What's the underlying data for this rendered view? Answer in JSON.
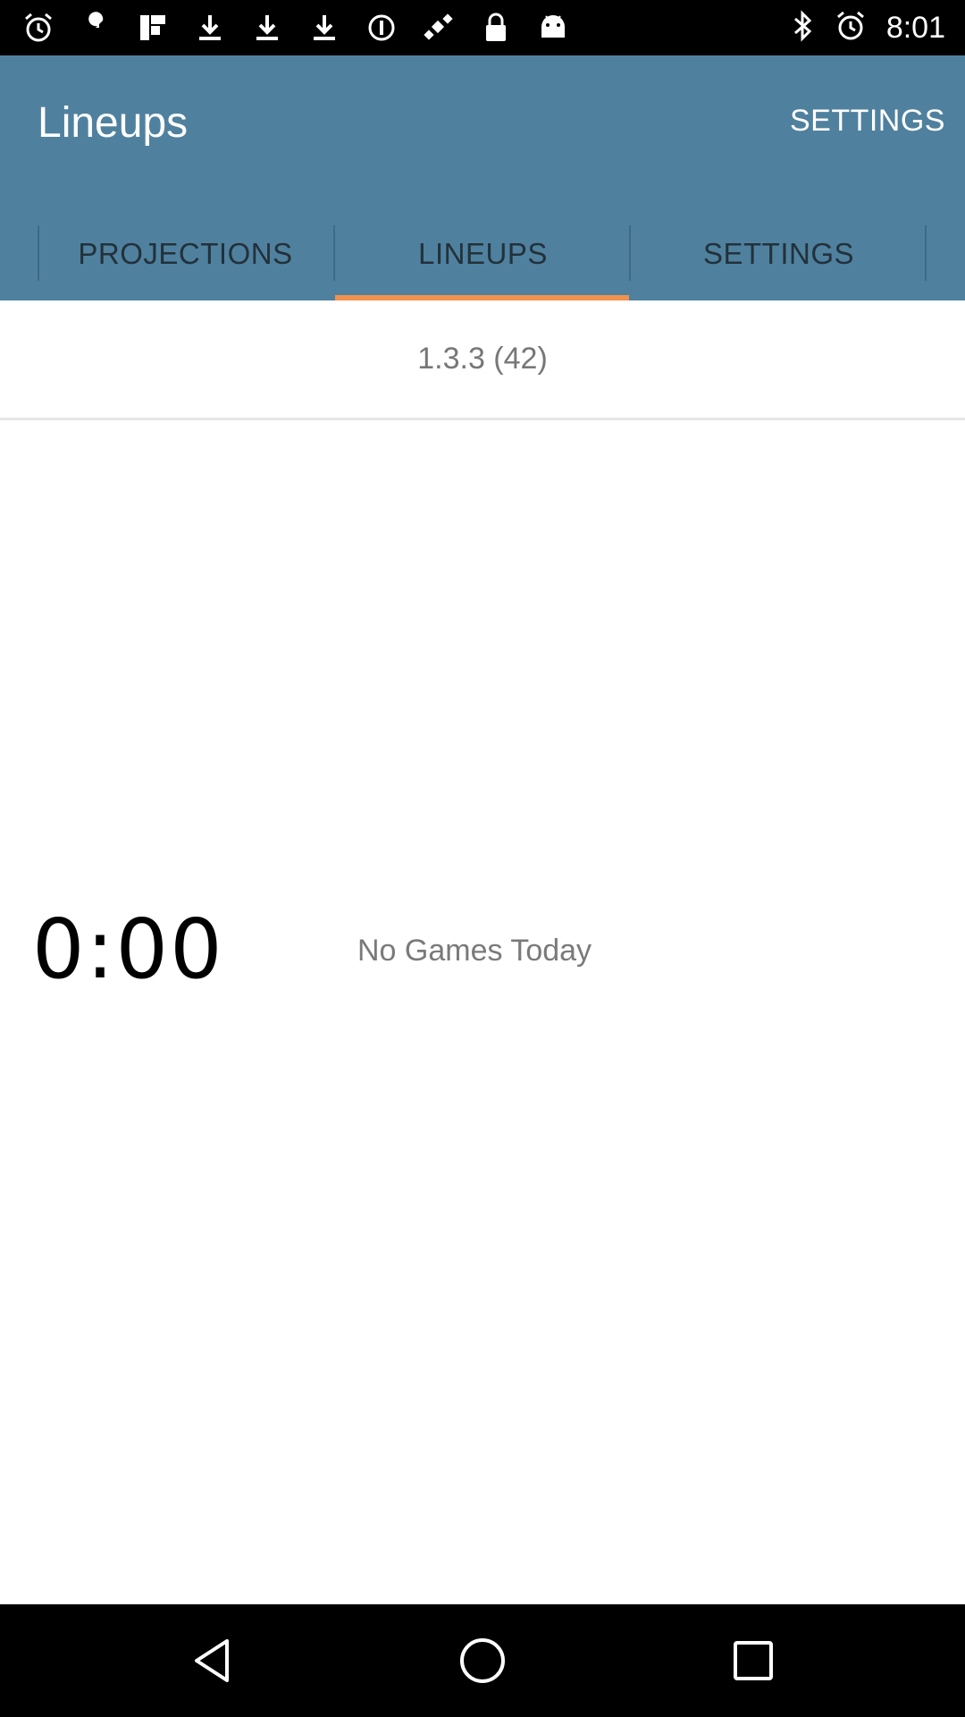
{
  "status_bar": {
    "time": "8:01",
    "left_icons": [
      "alarm-icon",
      "wrench-icon",
      "flipboard-icon",
      "download-icon",
      "download-icon",
      "download-icon",
      "data-saver-icon",
      "satellite-icon",
      "lock-icon",
      "android-icon"
    ],
    "right_icons": [
      "bluetooth-icon",
      "alarm-icon"
    ]
  },
  "app_bar": {
    "title": "Lineups",
    "settings_label": "SETTINGS",
    "color": "#4f819f"
  },
  "tabs": [
    {
      "label": "PROJECTIONS",
      "selected": false
    },
    {
      "label": "LINEUPS",
      "selected": true
    },
    {
      "label": "SETTINGS",
      "selected": false
    }
  ],
  "indicator_color": "#f2914e",
  "content": {
    "version": "1.3.3 (42)",
    "clock": "0:00",
    "message": "No Games Today"
  },
  "nav_bar": {
    "buttons": [
      "back-icon",
      "home-icon",
      "recents-icon"
    ]
  }
}
